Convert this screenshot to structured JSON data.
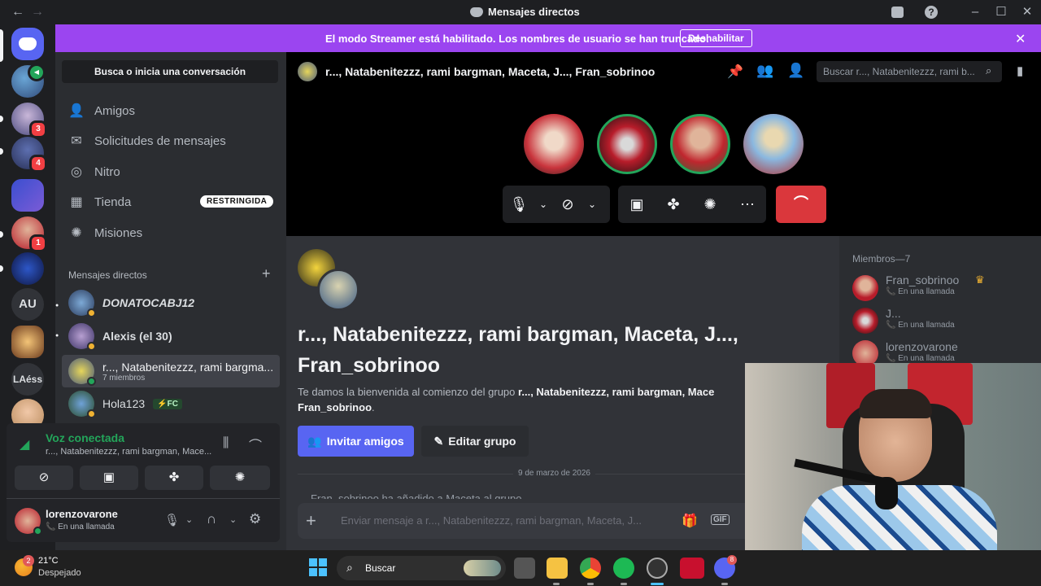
{
  "titlebar": {
    "title": "Mensajes directos"
  },
  "rail": {
    "badges": [
      "3",
      "4",
      "1"
    ],
    "text_servers": [
      "AU",
      "LAéss"
    ]
  },
  "banner": {
    "message": "El modo Streamer está habilitado. Los nombres de usuario se han truncado.",
    "button": "Deshabilitar"
  },
  "sidebar": {
    "search_placeholder": "Busca o inicia una conversación",
    "nav": [
      {
        "label": "Amigos",
        "icon": "friends-icon"
      },
      {
        "label": "Solicitudes de mensajes",
        "icon": "mail-icon"
      },
      {
        "label": "Nitro",
        "icon": "nitro-icon"
      },
      {
        "label": "Tienda",
        "icon": "shop-icon",
        "tag": "RESTRINGIDA"
      },
      {
        "label": "Misiones",
        "icon": "quests-icon"
      }
    ],
    "dm_header": "Mensajes directos",
    "dms": [
      {
        "name": "DONATOCABJ12",
        "sub": ""
      },
      {
        "name": "Alexis (el 30)",
        "sub": ""
      },
      {
        "name": "r..., Natabenitezzz, rami bargma...",
        "sub": "7 miembros"
      },
      {
        "name": "Hola123",
        "sub": "",
        "tag": "FC"
      }
    ]
  },
  "voice": {
    "status": "Voz conectada",
    "channel": "r..., Natabenitezzz, rami bargman, Mace..."
  },
  "user": {
    "name": "lorenzovarone",
    "status": "En una llamada"
  },
  "chat": {
    "header_title": "r..., Natabenitezzz, rami bargman, Maceta, J..., Fran_sobrinoo",
    "search_placeholder": "Buscar r..., Natabenitezzz, rami b...",
    "group_title_line1": "r..., Natabenitezzz, rami bargman, Maceta, J...,",
    "group_title_line2": "Fran_sobrinoo",
    "welcome_prefix": "Te damos la bienvenida al comienzo del grupo ",
    "welcome_names": "r..., Natabenitezzz, rami bargman, Mace",
    "welcome_names2": "Fran_sobrinoo",
    "welcome_suffix": ".",
    "invite_button": "Invitar amigos",
    "edit_button": "Editar grupo",
    "date_divider": "9 de marzo de 2026",
    "system_message": "Fran_sobrinoo ha añadido a Maceta al grupo. ...",
    "input_placeholder": "Enviar mensaje a r..., Natabenitezzz, rami bargman, Maceta, J..."
  },
  "members": {
    "header": "Miembros—7",
    "list": [
      {
        "name": "Fran_sobrinoo",
        "status": "En una llamada",
        "crown": true
      },
      {
        "name": "J...",
        "status": "En una llamada",
        "crown": false
      },
      {
        "name": "lorenzovarone",
        "status": "En una llamada",
        "crown": false
      }
    ]
  },
  "taskbar": {
    "weather_temp": "21°C",
    "weather_desc": "Despejado",
    "weather_badge": "2",
    "search_label": "Buscar",
    "discord_badge": "8"
  },
  "colors": {
    "banner": "#9b45f0",
    "blurple": "#5865f2",
    "green": "#23a55a",
    "hangup": "#da373c"
  }
}
